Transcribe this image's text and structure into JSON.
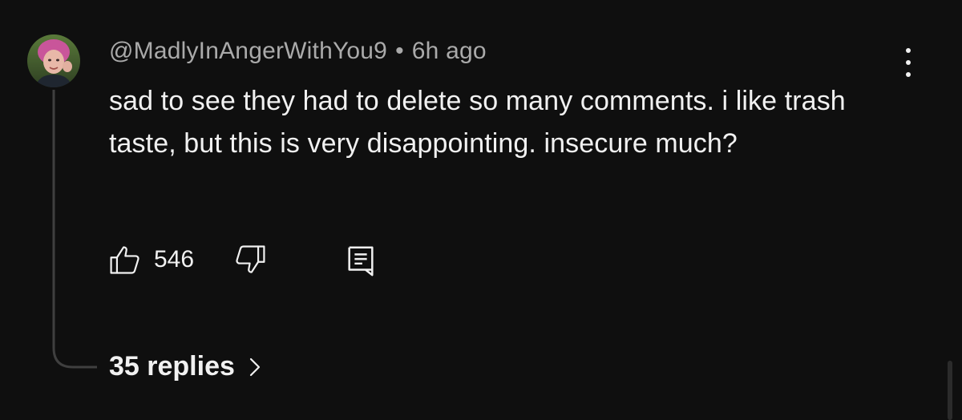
{
  "comment": {
    "author": "@MadlyInAngerWithYou9",
    "separator": "•",
    "timestamp": "6h ago",
    "text": "sad to see they had to delete so many comments. i like trash taste, but this is very disappointing. insecure much?",
    "like_count": "546",
    "replies_label": "35 replies"
  },
  "icons": {
    "like": "thumbs-up-icon",
    "dislike": "thumbs-down-icon",
    "reply": "comment-icon",
    "menu": "more-vertical-icon",
    "replies": "chevron-right-icon"
  },
  "colors": {
    "background": "#0f0f0f",
    "primary_text": "#f1f1f1",
    "secondary_text": "#aaaaaa",
    "thread_line": "#3f3f3f"
  }
}
